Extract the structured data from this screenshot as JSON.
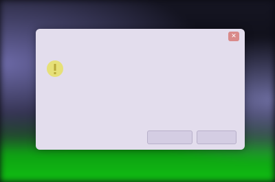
{
  "dialog": {
    "title": "",
    "message": "",
    "primary_button": "",
    "secondary_button": "",
    "close_glyph": "✕",
    "icon": "warning-icon"
  },
  "colors": {
    "dialog_bg": "#e3dded",
    "close_button": "#d98a8a",
    "desktop_green": "#0fbf12",
    "warning_yellow": "#e6e06a"
  }
}
